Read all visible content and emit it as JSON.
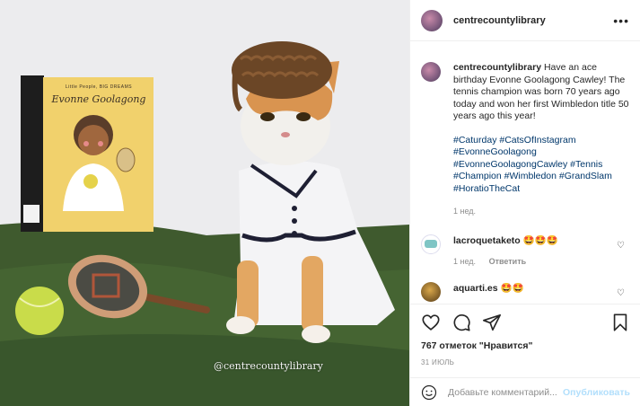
{
  "post": {
    "username": "centrecountylibrary",
    "more_icon": "more-horizontal-icon",
    "caption": {
      "username": "centrecountylibrary",
      "text": "Have an ace birthday Evonne Goolagong Cawley! The tennis champion was born 70 years ago today and won her first Wimbledon title 50 years ago this year!",
      "hashtags": "#Caturday #CatsOfInstagram #EvonneGoolagong #EvonneGoolagongCawley #Tennis #Champion #Wimbledon #GrandSlam #HoratioTheCat",
      "time": "1 нед."
    },
    "comments": [
      {
        "username": "lacroquetaketo",
        "text": "🤩🤩🤩",
        "time": "1 нед.",
        "reply": "Ответить"
      },
      {
        "username": "aquarti.es",
        "text": "🤩🤩",
        "time": "",
        "reply": ""
      }
    ],
    "likes": "767 отметок \"Нравится\"",
    "date": "31 ИЮЛЬ",
    "add_comment": {
      "placeholder": "Добавьте комментарий...",
      "publish": "Опубликовать"
    }
  },
  "photo": {
    "watermark": "@centrecountylibrary",
    "book_series": "Little People, BIG DREAMS",
    "book_title": "Evonne Goolagong"
  },
  "colors": {
    "link": "#00376b",
    "publish_disabled": "#b2dffc",
    "secondary_text": "#8e8e8e"
  }
}
